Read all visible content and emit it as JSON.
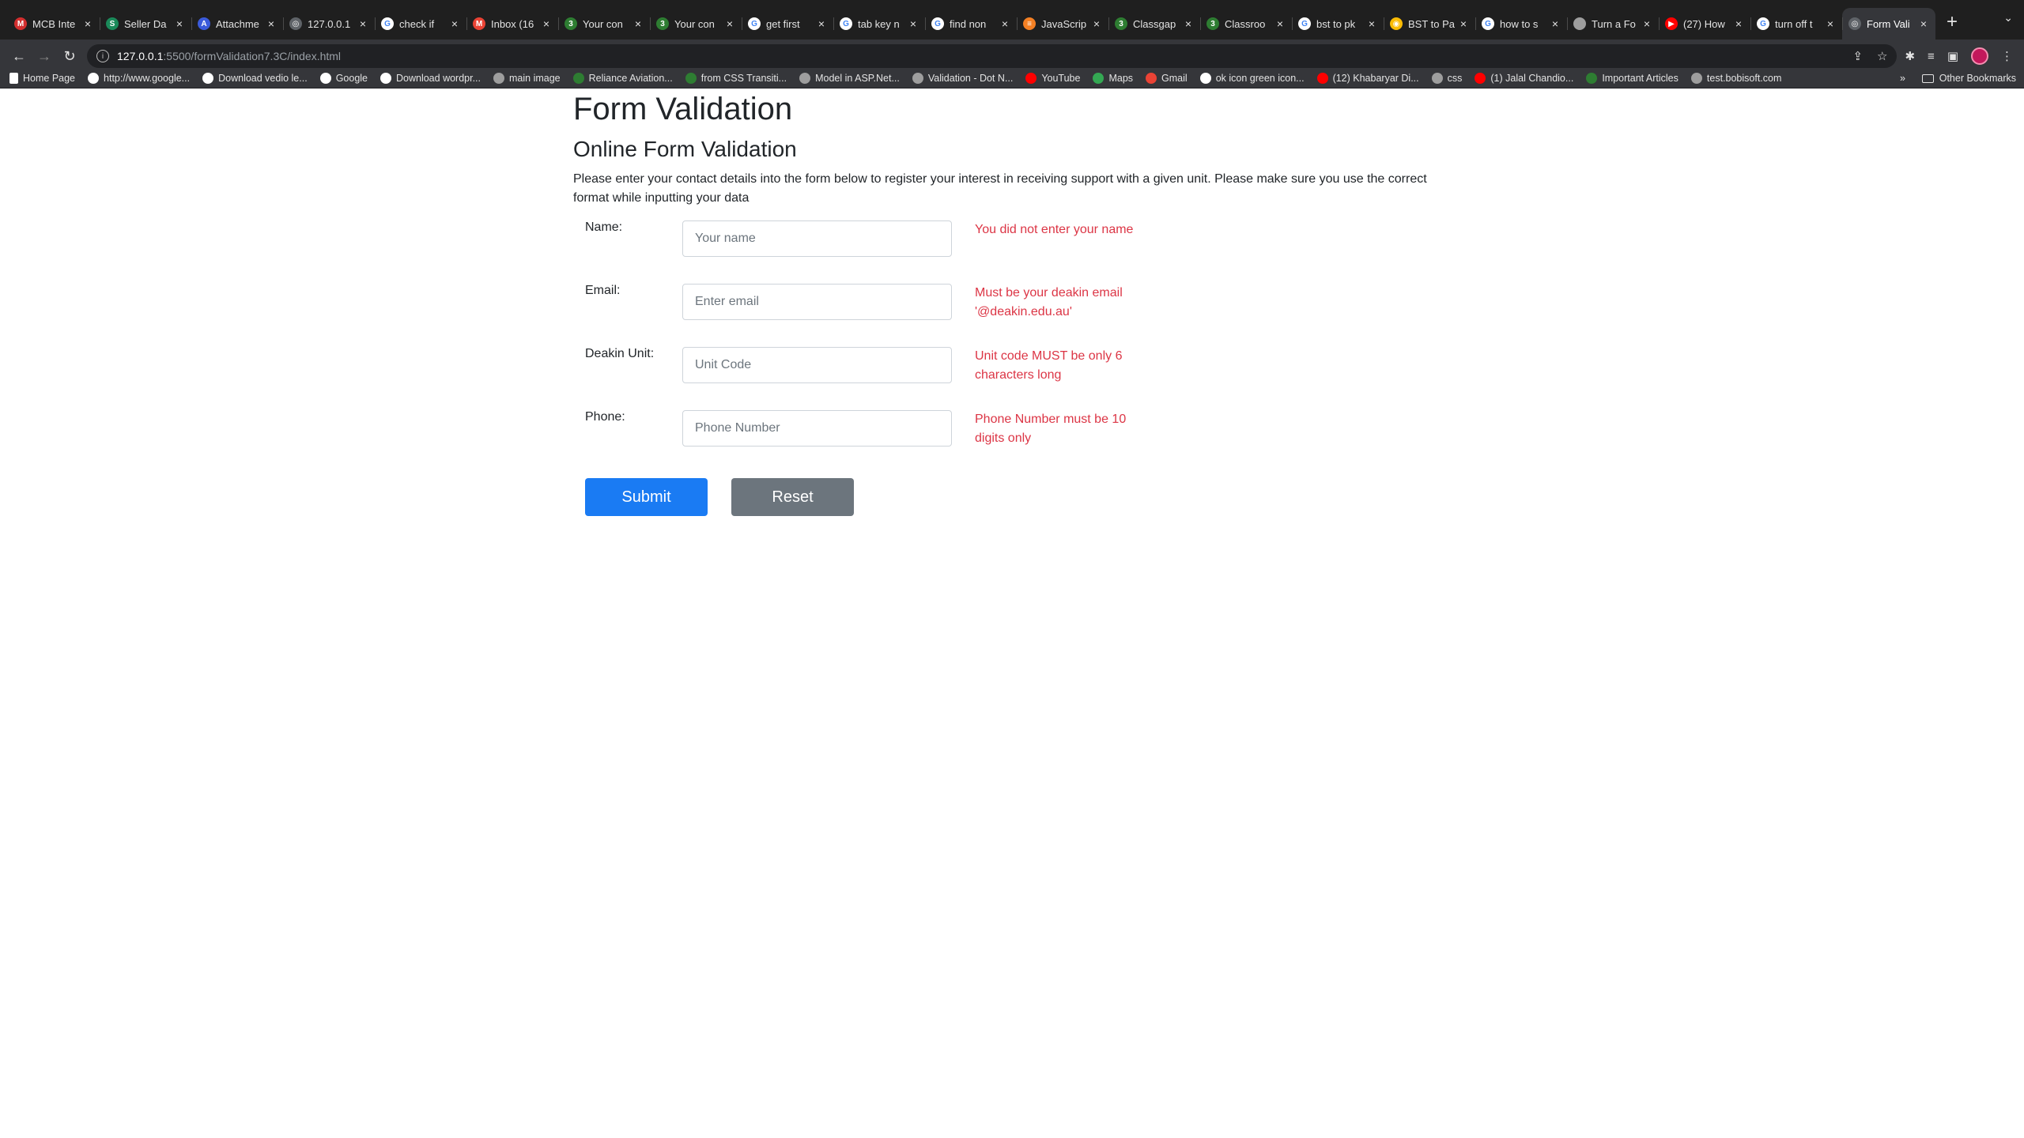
{
  "browser": {
    "tabs": [
      {
        "title": "MCB Inte",
        "icon": "mcb-icon",
        "color": "#d32f2f",
        "glyph": "M"
      },
      {
        "title": "Seller Da",
        "icon": "seller-icon",
        "color": "#1b8a5a",
        "glyph": "S"
      },
      {
        "title": "Attachme",
        "icon": "attachment-icon",
        "color": "#3b5bdb",
        "glyph": "A"
      },
      {
        "title": "127.0.0.1",
        "icon": "globe-icon",
        "color": "#5f6368",
        "glyph": "◎"
      },
      {
        "title": "check if",
        "icon": "google-icon",
        "color": "#ffffff",
        "glyph": "G"
      },
      {
        "title": "Inbox (16",
        "icon": "gmail-icon",
        "color": "#ea4335",
        "glyph": "M"
      },
      {
        "title": "Your con",
        "icon": "classgap-icon",
        "color": "#2e7d32",
        "glyph": "3"
      },
      {
        "title": "Your con",
        "icon": "classgap-icon",
        "color": "#2e7d32",
        "glyph": "3"
      },
      {
        "title": "get first",
        "icon": "google-icon",
        "color": "#ffffff",
        "glyph": "G"
      },
      {
        "title": "tab key n",
        "icon": "google-icon",
        "color": "#ffffff",
        "glyph": "G"
      },
      {
        "title": "find non",
        "icon": "google-icon",
        "color": "#ffffff",
        "glyph": "G"
      },
      {
        "title": "JavaScrip",
        "icon": "stackoverflow-icon",
        "color": "#f48024",
        "glyph": "≡"
      },
      {
        "title": "Classgap",
        "icon": "classgap-icon",
        "color": "#2e7d32",
        "glyph": "3"
      },
      {
        "title": "Classroo",
        "icon": "classgap-icon",
        "color": "#2e7d32",
        "glyph": "3"
      },
      {
        "title": "bst to pk",
        "icon": "google-icon",
        "color": "#ffffff",
        "glyph": "G"
      },
      {
        "title": "BST to Pa",
        "icon": "chrome-icon",
        "color": "#fbbc04",
        "glyph": "◉"
      },
      {
        "title": "how to s",
        "icon": "google-icon",
        "color": "#ffffff",
        "glyph": "G"
      },
      {
        "title": "Turn a Fo",
        "icon": "apple-icon",
        "color": "#9e9e9e",
        "glyph": ""
      },
      {
        "title": "(27) How",
        "icon": "youtube-icon",
        "color": "#ff0000",
        "glyph": "▶"
      },
      {
        "title": "turn off t",
        "icon": "google-icon",
        "color": "#ffffff",
        "glyph": "G"
      },
      {
        "title": "Form Vali",
        "icon": "globe-icon",
        "color": "#5f6368",
        "glyph": "◎"
      }
    ],
    "url_host": "127.0.0.1",
    "url_path": ":5500/formValidation7.3C/index.html",
    "bookmarks": [
      {
        "label": "Home Page",
        "icon": "page-icon",
        "color": "#ffffff"
      },
      {
        "label": "http://www.google...",
        "icon": "google-icon",
        "color": "#ffffff"
      },
      {
        "label": "Download vedio le...",
        "icon": "google-icon",
        "color": "#ffffff"
      },
      {
        "label": "Google",
        "icon": "google-icon",
        "color": "#ffffff"
      },
      {
        "label": "Download wordpr...",
        "icon": "google-icon",
        "color": "#ffffff"
      },
      {
        "label": "main image",
        "icon": "globe-icon",
        "color": "#9e9e9e"
      },
      {
        "label": "Reliance Aviation...",
        "icon": "reliance-icon",
        "color": "#2e7d32"
      },
      {
        "label": "from CSS Transiti...",
        "icon": "css-icon",
        "color": "#2e7d32"
      },
      {
        "label": "Model in ASP.Net...",
        "icon": "globe-icon",
        "color": "#9e9e9e"
      },
      {
        "label": "Validation - Dot N...",
        "icon": "globe-icon",
        "color": "#9e9e9e"
      },
      {
        "label": "YouTube",
        "icon": "youtube-icon",
        "color": "#ff0000"
      },
      {
        "label": "Maps",
        "icon": "maps-icon",
        "color": "#34a853"
      },
      {
        "label": "Gmail",
        "icon": "gmail-icon",
        "color": "#ea4335"
      },
      {
        "label": "ok icon green icon...",
        "icon": "google-icon",
        "color": "#ffffff"
      },
      {
        "label": "(12) Khabaryar Di...",
        "icon": "youtube-icon",
        "color": "#ff0000"
      },
      {
        "label": "css",
        "icon": "globe-icon",
        "color": "#9e9e9e"
      },
      {
        "label": "(1) Jalal Chandio...",
        "icon": "youtube-icon",
        "color": "#ff0000"
      },
      {
        "label": "Important Articles",
        "icon": "articles-icon",
        "color": "#2e7d32"
      },
      {
        "label": "test.bobisoft.com",
        "icon": "globe-icon",
        "color": "#9e9e9e"
      }
    ],
    "more_glyph": "»",
    "other_bookmarks": "Other Bookmarks"
  },
  "page": {
    "title": "Form Validation",
    "subtitle": "Online Form Validation",
    "intro": "Please enter your contact details into the form below to register your interest in receiving support with a given unit. Please make sure you use the correct format while inputting your data",
    "fields": {
      "name": {
        "label": "Name:",
        "placeholder": "Your name",
        "error": "You did not enter your name"
      },
      "email": {
        "label": "Email:",
        "placeholder": "Enter email",
        "error": "Must be your deakin email '@deakin.edu.au'"
      },
      "unit": {
        "label": "Deakin Unit:",
        "placeholder": "Unit Code",
        "error": "Unit code MUST be only 6 characters long"
      },
      "phone": {
        "label": "Phone:",
        "placeholder": "Phone Number",
        "error": "Phone Number must be 10 digits only"
      }
    },
    "submit_label": "Submit",
    "reset_label": "Reset",
    "colors": {
      "error": "#dc3545",
      "primary": "#1a7bf3",
      "secondary": "#6c757d"
    }
  }
}
